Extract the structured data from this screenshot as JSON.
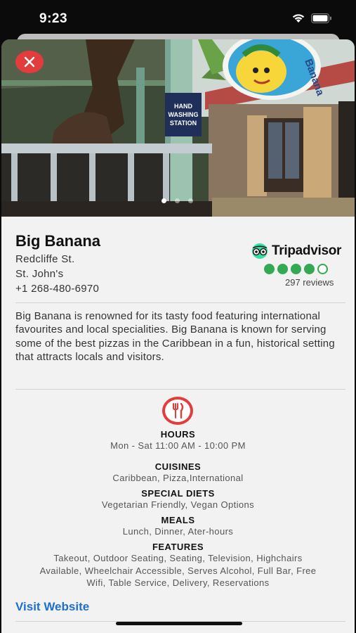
{
  "status_bar": {
    "time": "9:23"
  },
  "restaurant": {
    "name": "Big Banana",
    "address_line1": "Redcliffe St.",
    "address_line2": "St. John's",
    "phone": "+1 268-480-6970",
    "description": "Big Banana is renowned for its tasty food featuring international favourites and local specialities. Big Banana is known for serving some of the best pizzas in the Caribbean in a fun, historical setting that attracts locals and visitors."
  },
  "tripadvisor": {
    "brand": "Tripadvisor",
    "rating": 4,
    "max_rating": 5,
    "reviews": "297 reviews"
  },
  "hero": {
    "sign_text_1": "HAND",
    "sign_text_2": "WASHING",
    "sign_text_3": "STATION",
    "logo_text": "Banana",
    "carousel_pages": 3,
    "carousel_active": 1
  },
  "details": {
    "hours_title": "HOURS",
    "hours_value": "Mon - Sat 11:00 AM - 10:00 PM",
    "cuisines_title": "CUISINES",
    "cuisines_value": "Caribbean, Pizza,International",
    "diets_title": "SPECIAL DIETS",
    "diets_value": "Vegetarian Friendly, Vegan Options",
    "meals_title": "MEALS",
    "meals_value": "Lunch, Dinner, Ater-hours",
    "features_title": "FEATURES",
    "features_line1": "Takeout, Outdoor Seating, Seating, Television, Highchairs",
    "features_line2": "Available, Wheelchair Accessible, Serves Alcohol, Full Bar, Free",
    "features_line3": "Wifi, Table Service, Delivery, Reservations"
  },
  "links": {
    "visit_website": "Visit Website"
  },
  "colors": {
    "accent_red": "#e33c3c",
    "rating_green": "#34a853",
    "link_blue": "#1e6fd0"
  }
}
